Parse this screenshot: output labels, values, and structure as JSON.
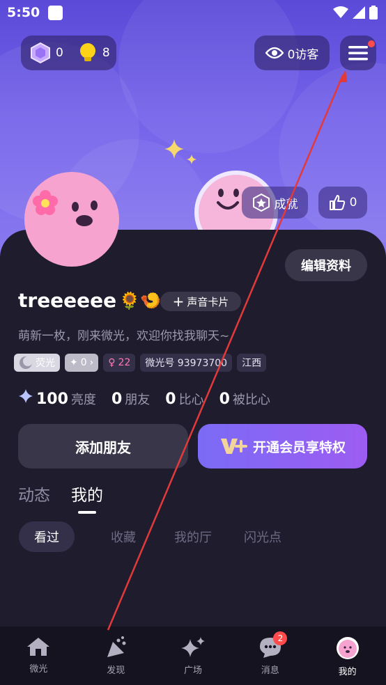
{
  "status_bar": {
    "time": "5:50"
  },
  "header": {
    "gems": "0",
    "bulbs": "8",
    "visitors": "0访客"
  },
  "profile": {
    "achievements_label": "成就",
    "likes": "0",
    "edit_label": "编辑资料",
    "username": "treeeeee",
    "username_emojis": "🌻🍤",
    "voice_card_label": "声音卡片",
    "bio": "萌新一枚，刚来微光，欢迎你找我聊天~",
    "tags": {
      "level": "荧光",
      "silver": "0",
      "age": "22",
      "id": "微光号 93973700",
      "region": "江西"
    },
    "stats": [
      {
        "num": "100",
        "label": "亮度"
      },
      {
        "num": "0",
        "label": "朋友"
      },
      {
        "num": "0",
        "label": "比心"
      },
      {
        "num": "0",
        "label": "被比心"
      }
    ],
    "add_friend_label": "添加朋友",
    "vip_label": "开通会员享特权"
  },
  "tabs": [
    {
      "label": "动态",
      "active": false
    },
    {
      "label": "我的",
      "active": true
    }
  ],
  "subtabs": [
    {
      "label": "看过",
      "active": true
    },
    {
      "label": "收藏",
      "active": false
    },
    {
      "label": "我的厅",
      "active": false
    },
    {
      "label": "闪光点",
      "active": false
    }
  ],
  "nav": [
    {
      "label": "微光",
      "icon": "home-icon"
    },
    {
      "label": "发现",
      "icon": "discover-icon"
    },
    {
      "label": "广场",
      "icon": "sparkle-icon"
    },
    {
      "label": "消息",
      "icon": "message-icon",
      "badge": "2"
    },
    {
      "label": "我的",
      "icon": "avatar-icon",
      "active": true
    }
  ],
  "colors": {
    "accent": "#7b6bf5",
    "background": "#1f1c2e",
    "annotation": "#e23a3a"
  }
}
